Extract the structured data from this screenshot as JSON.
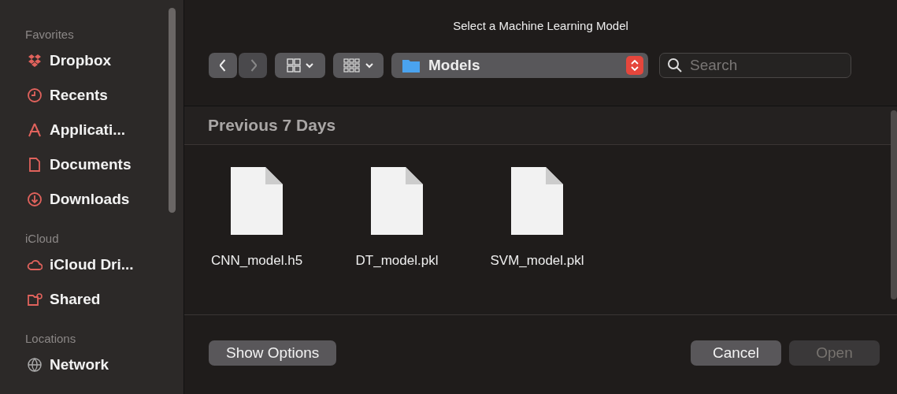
{
  "window": {
    "title": "Select a Machine Learning Model"
  },
  "sidebar": {
    "sections": [
      {
        "heading": "Favorites",
        "items": [
          {
            "label": "Dropbox"
          },
          {
            "label": "Recents"
          },
          {
            "label": "Applicati..."
          },
          {
            "label": "Documents"
          },
          {
            "label": "Downloads"
          }
        ]
      },
      {
        "heading": "iCloud",
        "items": [
          {
            "label": "iCloud Dri..."
          },
          {
            "label": "Shared"
          }
        ]
      },
      {
        "heading": "Locations",
        "items": [
          {
            "label": "Network"
          }
        ]
      }
    ]
  },
  "toolbar": {
    "back": {
      "disabled": false
    },
    "forward": {
      "disabled": true
    },
    "location": "Models",
    "search": {
      "placeholder": "Search"
    }
  },
  "browser": {
    "group": "Previous 7 Days",
    "files": [
      {
        "name": "CNN_model.h5"
      },
      {
        "name": "DT_model.pkl"
      },
      {
        "name": "SVM_model.pkl"
      }
    ]
  },
  "buttons": [
    {
      "label": "Show Options",
      "disabled": false
    },
    {
      "label": "Cancel",
      "disabled": false
    },
    {
      "label": "Open",
      "disabled": true
    }
  ]
}
